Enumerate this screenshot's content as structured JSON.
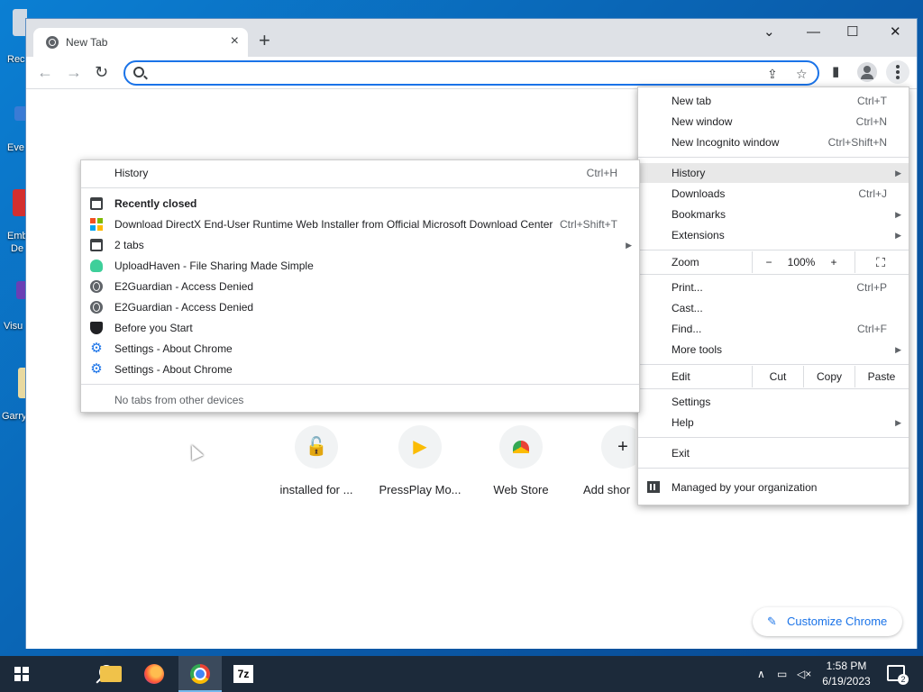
{
  "desktop": {
    "icons": [
      {
        "label": "Rec"
      },
      {
        "label": "Eve"
      },
      {
        "label": "Emb"
      },
      {
        "label": "De"
      },
      {
        "label": "Visu"
      },
      {
        "label": "Garry"
      }
    ]
  },
  "browser": {
    "tab": {
      "title": "New Tab",
      "close": "×"
    },
    "new_tab": "+",
    "window_controls": {
      "tabsearch": "⌄",
      "minimize": "—",
      "maximize": "☐",
      "close": "✕"
    },
    "nav": {
      "back": "←",
      "forward": "→",
      "reload": "↻"
    },
    "omnibox": {
      "value": "",
      "placeholder": ""
    }
  },
  "new_tab_page": {
    "shortcuts": [
      {
        "label": "installed for ...",
        "icon": "lock-icon"
      },
      {
        "label": "PressPlay Mo...",
        "icon": "pressplay-icon"
      },
      {
        "label": "Web Store",
        "icon": "webstore-icon"
      },
      {
        "label": "Add shor",
        "icon": "plus-icon"
      }
    ],
    "customize_label": "Customize Chrome"
  },
  "menu": {
    "new_tab": {
      "label": "New tab",
      "shortcut": "Ctrl+T"
    },
    "new_window": {
      "label": "New window",
      "shortcut": "Ctrl+N"
    },
    "incognito": {
      "label": "New Incognito window",
      "shortcut": "Ctrl+Shift+N"
    },
    "history": {
      "label": "History"
    },
    "downloads": {
      "label": "Downloads",
      "shortcut": "Ctrl+J"
    },
    "bookmarks": {
      "label": "Bookmarks"
    },
    "extensions": {
      "label": "Extensions"
    },
    "zoom": {
      "label": "Zoom",
      "minus": "−",
      "value": "100%",
      "plus": "+"
    },
    "print": {
      "label": "Print...",
      "shortcut": "Ctrl+P"
    },
    "cast": {
      "label": "Cast..."
    },
    "find": {
      "label": "Find...",
      "shortcut": "Ctrl+F"
    },
    "more_tools": {
      "label": "More tools"
    },
    "edit": {
      "label": "Edit",
      "cut": "Cut",
      "copy": "Copy",
      "paste": "Paste"
    },
    "settings": {
      "label": "Settings"
    },
    "help": {
      "label": "Help"
    },
    "exit": {
      "label": "Exit"
    },
    "managed": {
      "label": "Managed by your organization"
    }
  },
  "history_submenu": {
    "history": {
      "label": "History",
      "shortcut": "Ctrl+H"
    },
    "recently_closed": "Recently closed",
    "items": [
      {
        "label": "Download DirectX End-User Runtime Web Installer from Official Microsoft Download Center",
        "shortcut": "Ctrl+Shift+T",
        "icon": "microsoft-icon"
      },
      {
        "label": "2 tabs",
        "shortcut": "",
        "icon": "tab-icon"
      },
      {
        "label": "UploadHaven - File Sharing Made Simple",
        "shortcut": "",
        "icon": "cloud-icon"
      },
      {
        "label": "E2Guardian - Access Denied",
        "shortcut": "",
        "icon": "globe-icon"
      },
      {
        "label": "E2Guardian - Access Denied",
        "shortcut": "",
        "icon": "globe-icon"
      },
      {
        "label": "Before you Start",
        "shortcut": "",
        "icon": "shield-icon"
      },
      {
        "label": "Settings - About Chrome",
        "shortcut": "",
        "icon": "gear-icon"
      },
      {
        "label": "Settings - About Chrome",
        "shortcut": "",
        "icon": "gear-icon"
      }
    ],
    "no_tabs": "No tabs from other devices"
  },
  "taskbar": {
    "time": "1:58 PM",
    "date": "6/19/2023",
    "notifications": "2",
    "seven_zip": "7z"
  }
}
